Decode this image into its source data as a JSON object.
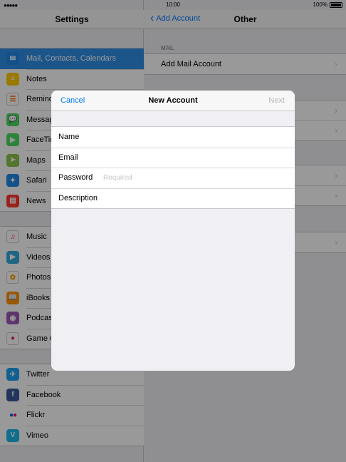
{
  "status": {
    "signal": "●●●●●",
    "time": "10:00",
    "battery": "100%"
  },
  "master": {
    "title": "Settings",
    "groups": [
      [
        {
          "label": "Mail, Contacts, Calendars",
          "icon": "mail-icon",
          "color": "#1e88e5",
          "selected": true
        },
        {
          "label": "Notes",
          "icon": "notes-icon",
          "color": "#ffcc00"
        },
        {
          "label": "Reminders",
          "icon": "reminders-icon",
          "color": "#ffffff"
        },
        {
          "label": "Messages",
          "icon": "messages-icon",
          "color": "#4cd964"
        },
        {
          "label": "FaceTime",
          "icon": "facetime-icon",
          "color": "#4cd964"
        },
        {
          "label": "Maps",
          "icon": "maps-icon",
          "color": "#8bc34a"
        },
        {
          "label": "Safari",
          "icon": "safari-icon",
          "color": "#1e88e5"
        },
        {
          "label": "News",
          "icon": "news-icon",
          "color": "#ff3b30"
        }
      ],
      [
        {
          "label": "Music",
          "icon": "music-icon",
          "color": "#ffffff"
        },
        {
          "label": "Videos",
          "icon": "videos-icon",
          "color": "#34aadc"
        },
        {
          "label": "Photos",
          "icon": "photos-icon",
          "color": "#ffffff"
        },
        {
          "label": "iBooks",
          "icon": "ibooks-icon",
          "color": "#ff9500"
        },
        {
          "label": "Podcasts",
          "icon": "podcasts-icon",
          "color": "#9b59b6"
        },
        {
          "label": "Game Center",
          "icon": "game-center-icon",
          "color": "#ffffff"
        }
      ],
      [
        {
          "label": "Twitter",
          "icon": "twitter-icon",
          "color": "#1da1f2"
        },
        {
          "label": "Facebook",
          "icon": "facebook-icon",
          "color": "#3b5998"
        },
        {
          "label": "Flickr",
          "icon": "flickr-icon",
          "color": "#ffffff"
        },
        {
          "label": "Vimeo",
          "icon": "vimeo-icon",
          "color": "#1ab7ea"
        }
      ]
    ]
  },
  "detail": {
    "back_label": "Add Account",
    "title": "Other",
    "mail_header": "MAIL",
    "add_mail_label": "Add Mail Account"
  },
  "modal": {
    "cancel": "Cancel",
    "title": "New Account",
    "next": "Next",
    "fields": [
      {
        "label": "Name",
        "value": "",
        "placeholder": ""
      },
      {
        "label": "Email",
        "value": "",
        "placeholder": ""
      },
      {
        "label": "Password",
        "value": "",
        "placeholder": "Required"
      },
      {
        "label": "Description",
        "value": "",
        "placeholder": ""
      }
    ]
  }
}
